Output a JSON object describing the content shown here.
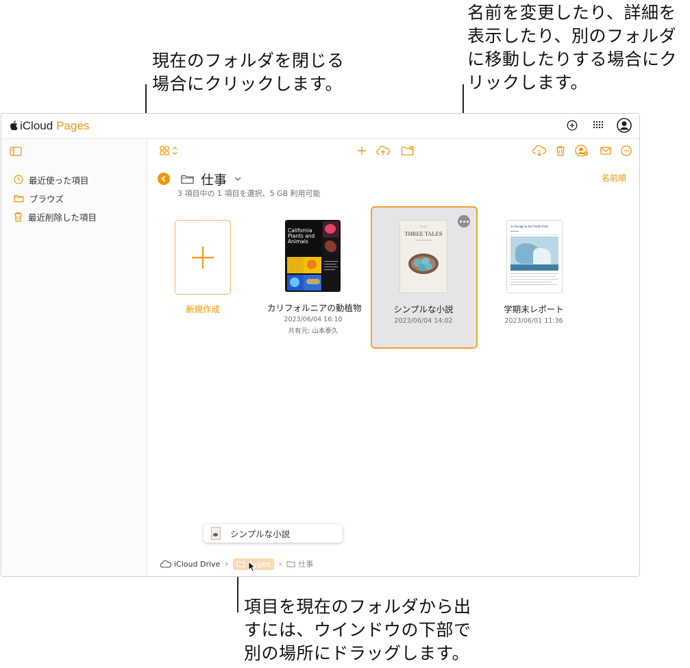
{
  "callouts": {
    "top_left": "現在のフォルダを閉じる\n場合にクリックします。",
    "top_right": "名前を変更したり、詳細を\n表示したり、別のフォルダ\nに移動したりする場合にク\nリックします。",
    "bottom": "項目を現在のフォルダから出\nすには、ウインドウの下部で\n別の場所にドラッグします。"
  },
  "app": {
    "name_icloud": "iCloud",
    "name_pages": "Pages",
    "accent_color": "#f0960a"
  },
  "sidebar": {
    "items": [
      {
        "label": "最近使った項目",
        "icon": "clock-icon"
      },
      {
        "label": "ブラウズ",
        "icon": "folder-icon"
      },
      {
        "label": "最近削除した項目",
        "icon": "trash-icon"
      }
    ]
  },
  "folder": {
    "title": "仕事",
    "subinfo": "3 項目中の 1 項目を選択、5 GB 利用可能",
    "sort_label": "名前順"
  },
  "documents": {
    "new": {
      "label": "新規作成"
    },
    "items": [
      {
        "name": "カリフォルニアの動植物",
        "date": "2023/06/04 16:10",
        "shared": "共有元: 山本泰久",
        "thumb_title": "California Plants and Animals"
      },
      {
        "name": "シンプルな小説",
        "date": "2023/06/04 14:02",
        "thumb_title": "THREE TALES",
        "thumb_small": "TALES",
        "selected": true
      },
      {
        "name": "学期末レポート",
        "date": "2023/06/01 11:36",
        "thumb_title": "A Voyage to the North Pole"
      }
    ]
  },
  "drag": {
    "label": "シンプルな小説"
  },
  "breadcrumb": {
    "root": "iCloud Drive",
    "middle": "Pages",
    "current": "仕事"
  }
}
